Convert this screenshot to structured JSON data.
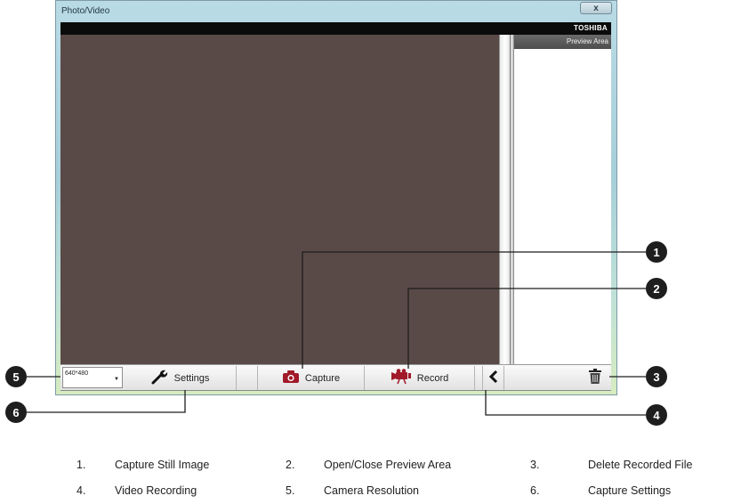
{
  "window": {
    "title": "Photo/Video",
    "close_label": "x",
    "brand": "TOSHIBA"
  },
  "preview": {
    "title": "Preview Area"
  },
  "toolbar": {
    "resolution": "640*480",
    "settings_label": "Settings",
    "capture_label": "Capture",
    "record_label": "Record"
  },
  "callouts": [
    "1",
    "2",
    "3",
    "4",
    "5",
    "6"
  ],
  "legend": [
    {
      "num": "1.",
      "text": "Capture Still Image"
    },
    {
      "num": "2.",
      "text": "Open/Close Preview Area"
    },
    {
      "num": "3.",
      "text": "Delete Recorded File"
    },
    {
      "num": "4.",
      "text": "Video Recording"
    },
    {
      "num": "5.",
      "text": "Camera Resolution"
    },
    {
      "num": "6.",
      "text": "Capture Settings"
    }
  ],
  "colors": {
    "viewport": "#5a4a47",
    "accent_icon": "#a11a2a",
    "callout": "#1e1e1e"
  },
  "icons": {
    "settings": "wrench-icon",
    "capture": "camera-icon",
    "record": "video-camera-icon",
    "toggle": "chevron-left-icon",
    "delete": "trash-icon",
    "dropdown": "chevron-down-icon"
  }
}
